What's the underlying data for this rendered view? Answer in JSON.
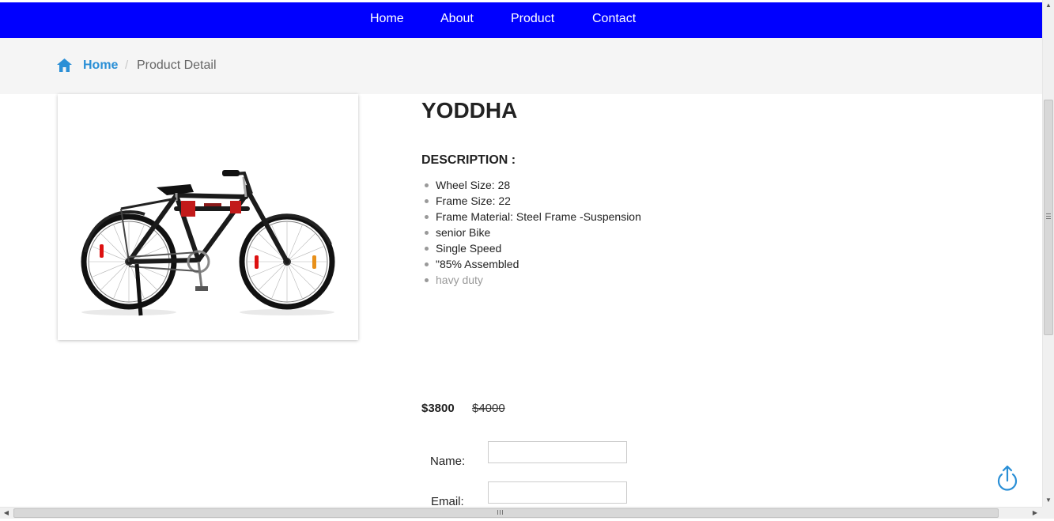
{
  "nav": {
    "items": [
      {
        "label": "Home"
      },
      {
        "label": "About"
      },
      {
        "label": "Product"
      },
      {
        "label": "Contact"
      }
    ],
    "background_color": "#0000ff"
  },
  "breadcrumb": {
    "home_icon": "home-icon",
    "home_label": "Home",
    "separator": "/",
    "current_label": "Product Detail"
  },
  "product": {
    "image_icon": "bicycle-image",
    "title": "YODDHA",
    "description_heading": "DESCRIPTION :",
    "features": [
      "Wheel Size: 28",
      "Frame Size: 22",
      "Frame Material: Steel Frame -Suspension",
      "senior Bike",
      "Single Speed",
      "\"85% Assembled",
      "havy duty"
    ],
    "price": "$3800",
    "old_price": "$4000"
  },
  "form": {
    "name_label": "Name:",
    "name_value": "",
    "email_label": "Email:",
    "email_value": ""
  },
  "back_to_top": {
    "icon": "back-to-top-icon",
    "color": "#2a8fd6"
  },
  "colors": {
    "accent": "#2a8fd6",
    "breadcrumb_bg": "#f5f5f5"
  }
}
